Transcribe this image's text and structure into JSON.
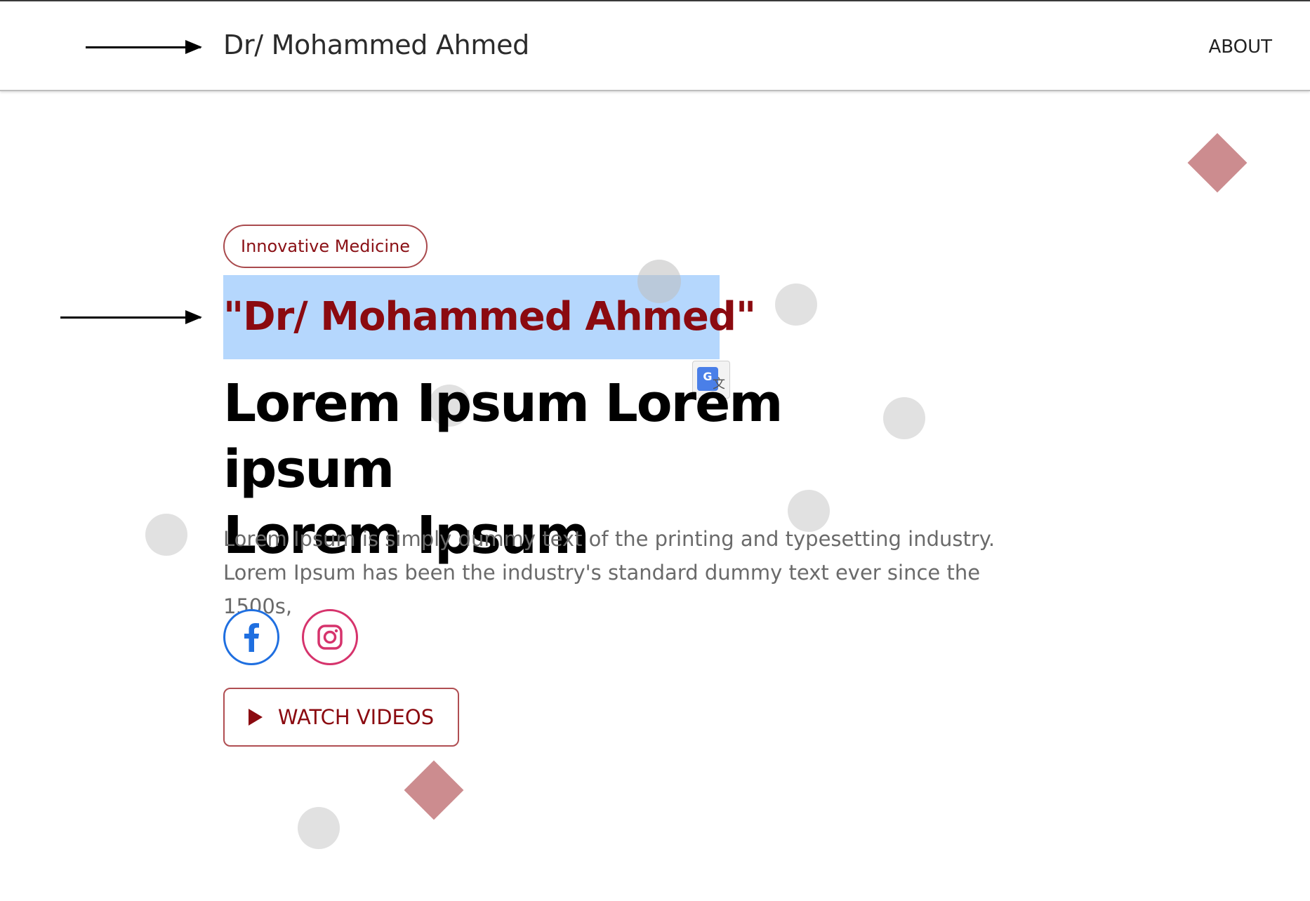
{
  "navbar": {
    "brand": "Dr/ Mohammed Ahmed",
    "links": [
      {
        "label": "ABOUT"
      }
    ]
  },
  "hero": {
    "tag": "Innovative Medicine",
    "name": "\"Dr/ Mohammed Ahmed\"",
    "headline_line1": "Lorem Ipsum Lorem ipsum",
    "headline_line2": "Lorem Ipsum",
    "description": "Lorem Ipsum is simply dummy text of the printing and typesetting industry. Lorem Ipsum has been the industry's standard dummy text ever since the 1500s,",
    "watch_button": "WATCH VIDEOS"
  },
  "colors": {
    "accent": "#8b0a10",
    "selection": "#b5d7fd",
    "decor_diamond": "#cc8c8f",
    "decor_dot": "#e1e1e1",
    "facebook": "#1f6fe0",
    "instagram": "#d6336c"
  },
  "icons": {
    "social": [
      "facebook-icon",
      "instagram-icon"
    ],
    "button": "play-icon",
    "annotation": "arrow-right-icon",
    "overlay": "google-translate-icon"
  }
}
